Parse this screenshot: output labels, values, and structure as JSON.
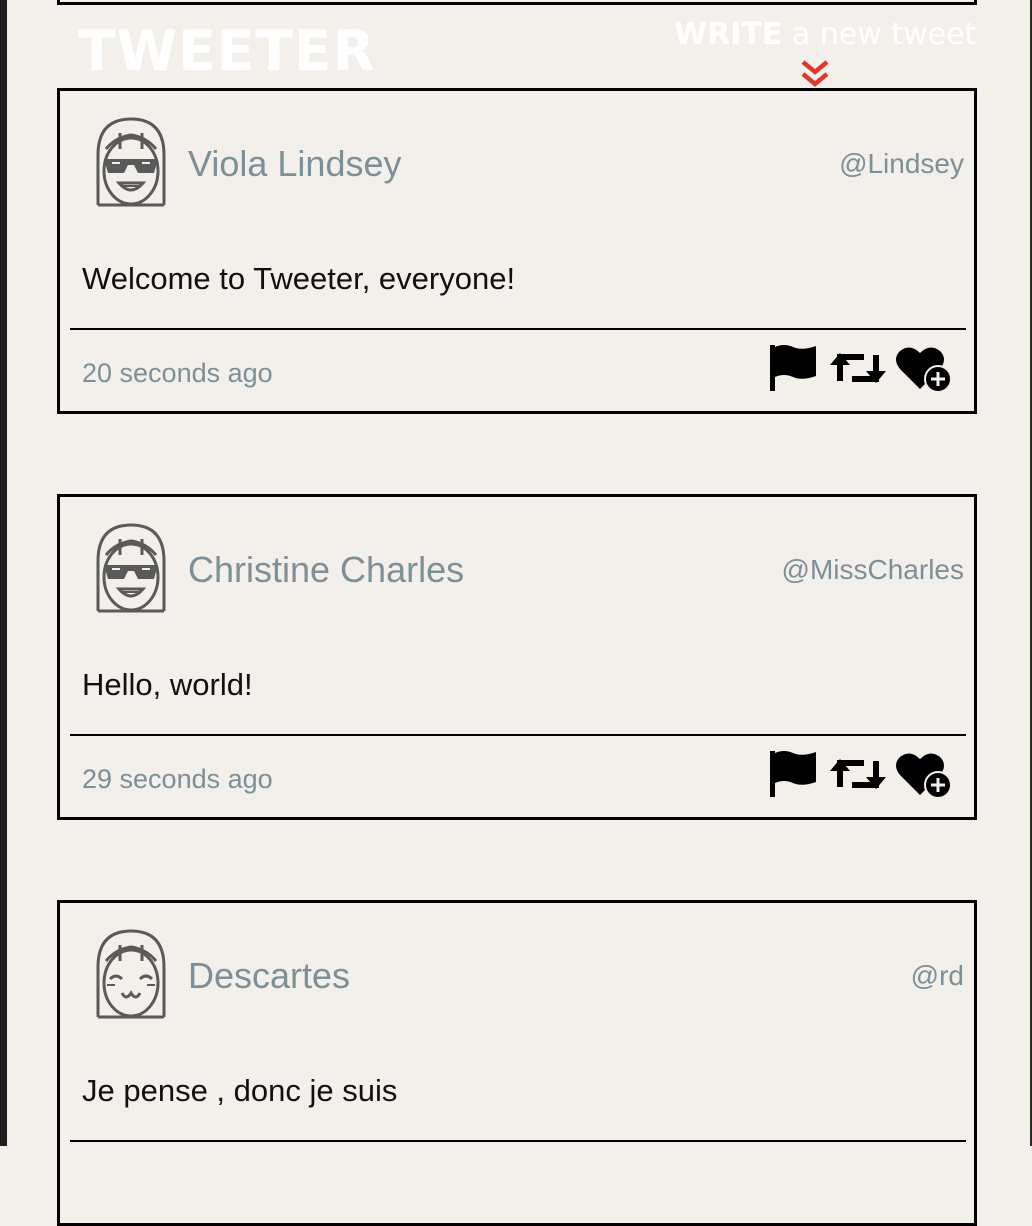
{
  "header": {
    "logo_text": "TWEETER",
    "compose_strong": "WRITE",
    "compose_light": "a new tweet",
    "accent_color": "#e0392b"
  },
  "tweets": [
    {
      "avatar": "avatar-sunglasses-icon",
      "name": "Viola Lindsey",
      "handle": "@Lindsey",
      "body": "Welcome to Tweeter, everyone!",
      "time": "20 seconds ago"
    },
    {
      "avatar": "avatar-sunglasses-icon",
      "name": "Christine Charles",
      "handle": "@MissCharles",
      "body": "Hello, world!",
      "time": "29 seconds ago"
    },
    {
      "avatar": "avatar-smiling-icon",
      "name": "Descartes",
      "handle": "@rd",
      "body": "Je pense , donc je suis",
      "time": ""
    }
  ],
  "actions": {
    "flag_icon": "flag-icon",
    "retweet_icon": "retweet-icon",
    "like_icon": "heart-plus-icon"
  },
  "colors": {
    "background": "#f3f0eb",
    "muted_text": "#7d8f97",
    "border": "#000000"
  }
}
